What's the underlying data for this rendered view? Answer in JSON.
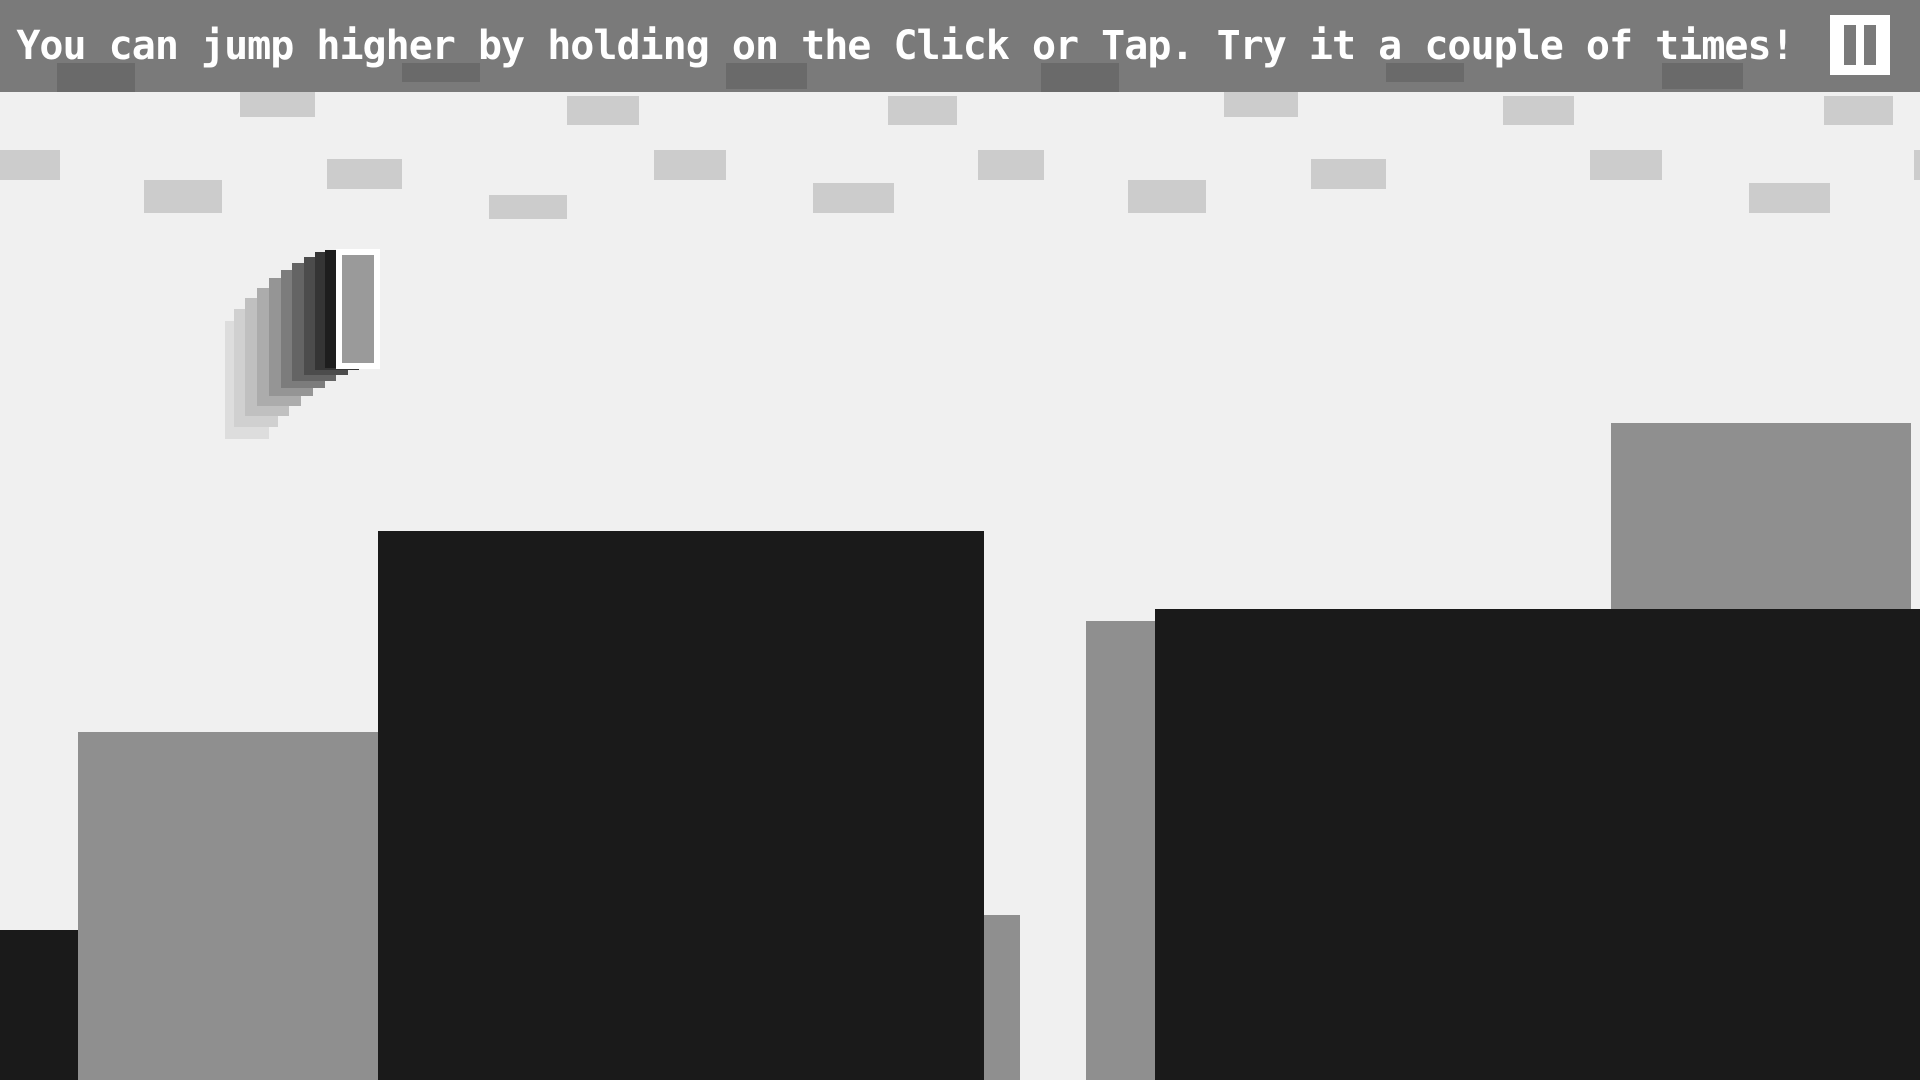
{
  "hud": {
    "tutorial_text": "You can jump higher by holding on the Click or Tap. Try it a couple of times!",
    "pause_icon": "pause-icon"
  },
  "colors": {
    "background": "#f0f0f0",
    "hud_bar": "#7a7a7a",
    "foreground_block": "#1a1a1a",
    "midground_block": "#8f8f8f",
    "cloud": "#cccccc",
    "player_fill": "#9a9a9a",
    "player_outline": "#ffffff"
  }
}
